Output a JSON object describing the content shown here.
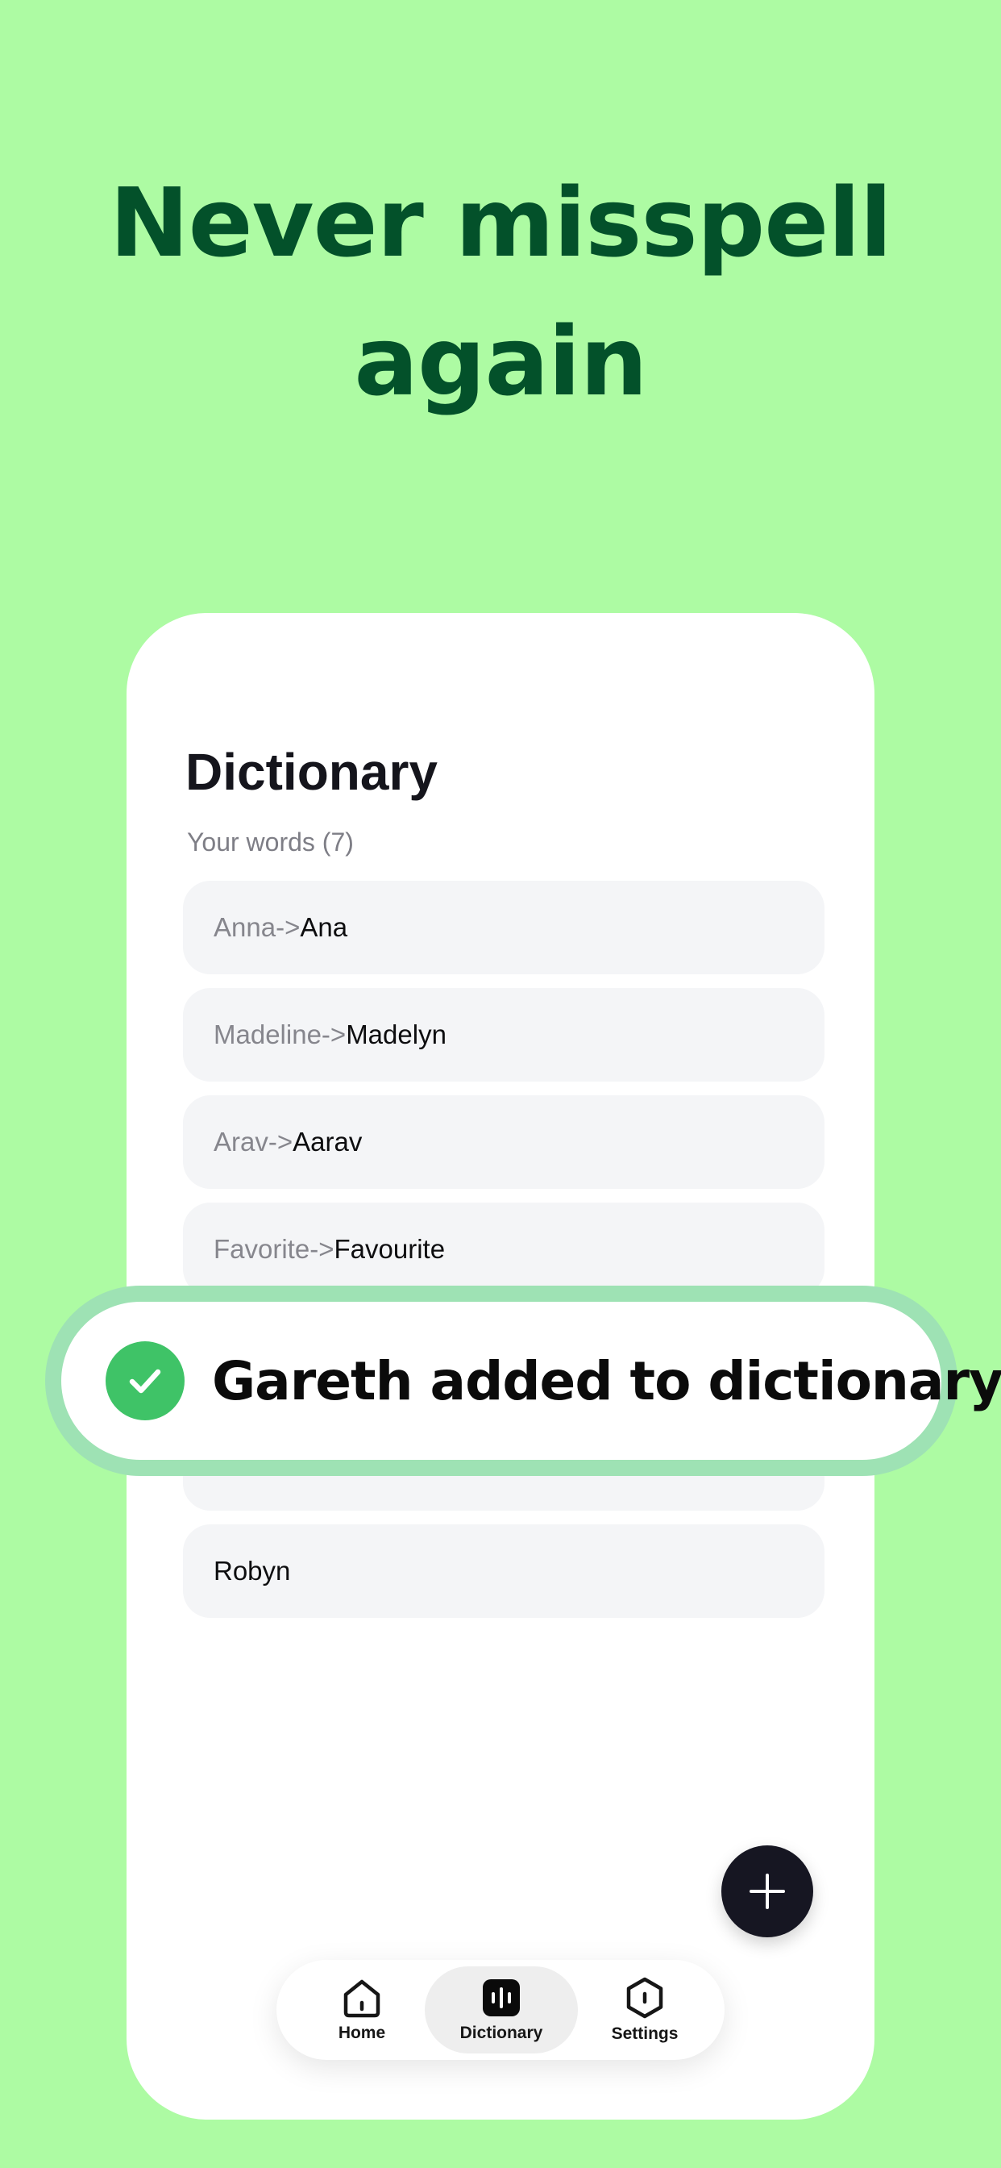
{
  "headline": {
    "line1": "Never misspell",
    "line2": "again"
  },
  "dictionary": {
    "title": "Dictionary",
    "subtitle": "Your words (7)",
    "words": [
      {
        "from": "Anna",
        "arrow": " ->",
        "to": " Ana"
      },
      {
        "from": "Madeline",
        "arrow": " ->",
        "to": " Madelyn"
      },
      {
        "from": "Arav",
        "arrow": " ->",
        "to": " Aarav"
      },
      {
        "from": "Favorite",
        "arrow": " ->",
        "to": " Favourite"
      },
      {
        "from": "",
        "arrow": "",
        "to": ""
      },
      {
        "from": "",
        "arrow": "",
        "to": ""
      },
      {
        "from": "",
        "arrow": "",
        "to": "Robyn"
      }
    ]
  },
  "toast": {
    "message": "Gareth added to dictionary"
  },
  "fab": {
    "icon": "plus-icon"
  },
  "tabbar": {
    "home_label": "Home",
    "dictionary_label": "Dictionary",
    "settings_label": "Settings"
  },
  "colors": {
    "background": "#adfba3",
    "headline": "#03512a",
    "toast_border": "#9ee2b4",
    "check": "#3fc367",
    "fab": "#161622"
  }
}
